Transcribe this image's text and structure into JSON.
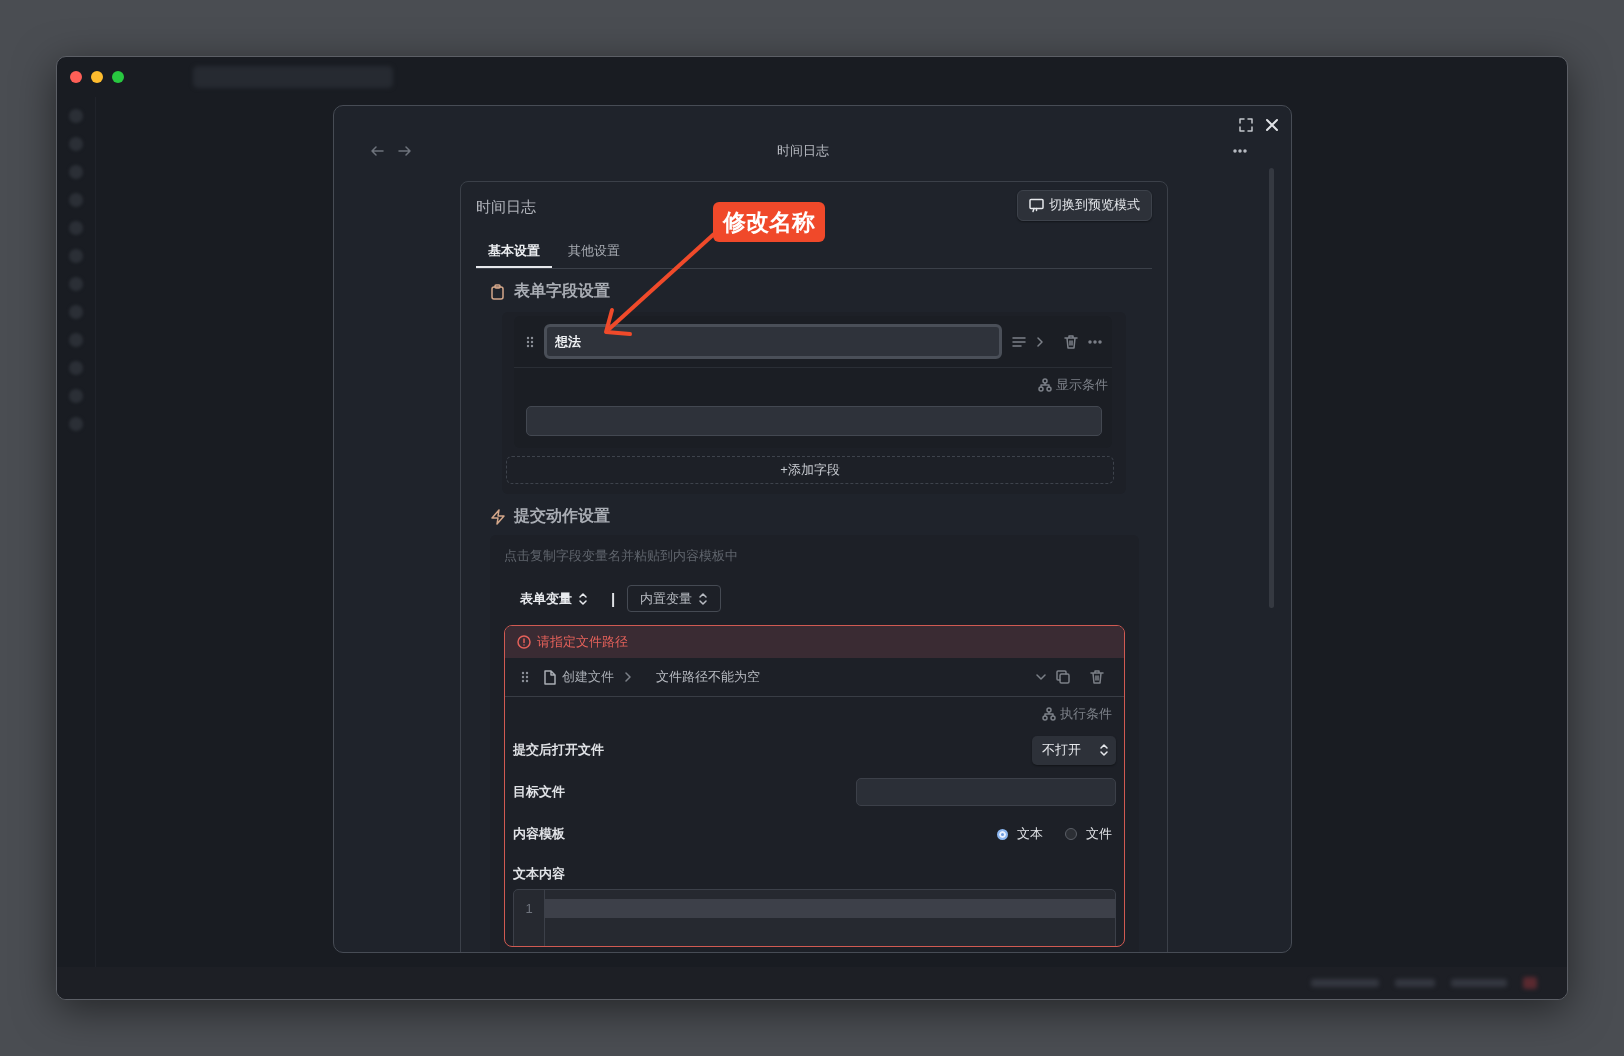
{
  "modal": {
    "title": "时间日志"
  },
  "card": {
    "title": "时间日志",
    "preview_button": "切换到预览模式",
    "tabs": [
      {
        "label": "基本设置",
        "selected": true
      },
      {
        "label": "其他设置",
        "selected": false
      }
    ],
    "form_section": {
      "title": "表单字段设置",
      "fields": [
        {
          "name": "想法",
          "condition_link": "显示条件"
        }
      ],
      "add_button": "+添加字段"
    },
    "action_section": {
      "title": "提交动作设置",
      "hint": "点击复制字段变量名并粘贴到内容模板中",
      "variable_selects": [
        {
          "label": "表单变量",
          "outlined": false
        },
        {
          "label": "内置变量",
          "outlined": true
        }
      ],
      "separator": "|",
      "action": {
        "error": "请指定文件路径",
        "type": "创建文件",
        "summary": "文件路径不能为空",
        "condition_link": "执行条件",
        "open_after": {
          "label": "提交后打开文件",
          "value": "不打开"
        },
        "target_file": {
          "label": "目标文件"
        },
        "template": {
          "label": "内容模板",
          "options": [
            {
              "label": "文本",
              "selected": true
            },
            {
              "label": "文件",
              "selected": false
            }
          ]
        },
        "text_content": {
          "label": "文本内容",
          "line_numbers": [
            "1"
          ]
        }
      }
    }
  },
  "annotation": {
    "label": "修改名称"
  }
}
